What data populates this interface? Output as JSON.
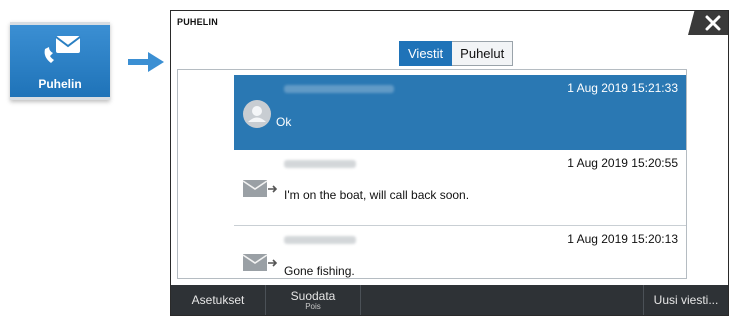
{
  "app_tile": {
    "label": "Puhelin",
    "icon": "phone-message-icon",
    "color": "#2a82c8"
  },
  "dialog": {
    "title": "PUHELIN",
    "tabs": [
      {
        "label": "Viestit",
        "active": true
      },
      {
        "label": "Puhelut",
        "active": false
      }
    ],
    "messages": [
      {
        "sender": "",
        "timestamp": "1 Aug 2019 15:21:33",
        "text": "Ok",
        "icon": "contact-avatar-icon",
        "selected": true
      },
      {
        "sender": "",
        "timestamp": "1 Aug 2019 15:20:55",
        "text": "I'm on the boat, will call back soon.",
        "icon": "outgoing-message-icon",
        "selected": false
      },
      {
        "sender": "",
        "timestamp": "1 Aug 2019 15:20:13",
        "text": "Gone fishing.",
        "icon": "outgoing-message-icon",
        "selected": false
      }
    ]
  },
  "bottom_bar": {
    "settings_label": "Asetukset",
    "filter_label": "Suodata",
    "filter_value": "Pois",
    "new_message_label": "Uusi viesti..."
  },
  "colors": {
    "accent": "#1f73b8",
    "selected_row": "#2a78b3",
    "bar": "#2e3236"
  }
}
